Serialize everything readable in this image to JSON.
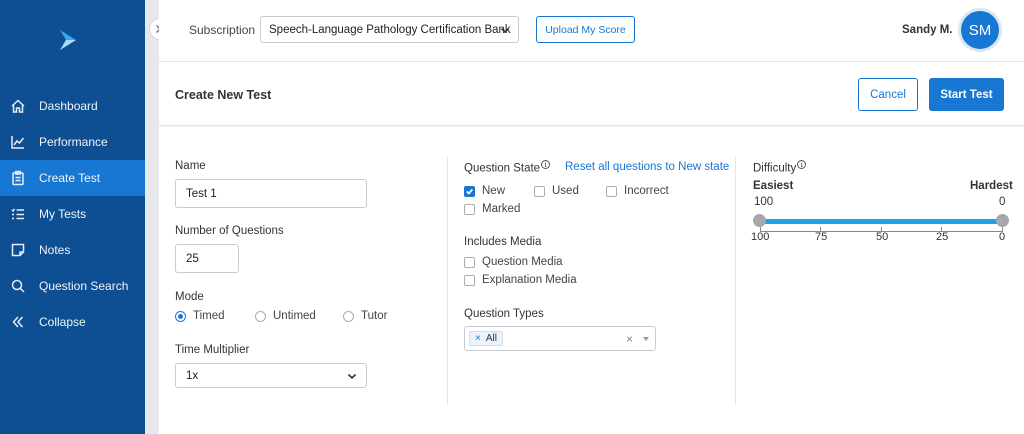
{
  "sidebar": {
    "items": [
      {
        "label": "Dashboard",
        "icon": "home-icon"
      },
      {
        "label": "Performance",
        "icon": "line-chart-icon"
      },
      {
        "label": "Create Test",
        "icon": "clipboard-icon",
        "active": true
      },
      {
        "label": "My Tests",
        "icon": "list-icon"
      },
      {
        "label": "Notes",
        "icon": "note-icon"
      },
      {
        "label": "Question Search",
        "icon": "search-icon"
      },
      {
        "label": "Collapse",
        "icon": "double-chevron-left-icon"
      }
    ]
  },
  "header": {
    "subscription_label": "Subscription",
    "subscription_value": "Speech-Language Pathology Certification Bank",
    "upload_label": "Upload My Score",
    "user_name": "Sandy M.",
    "avatar_initials": "SM"
  },
  "toolbar": {
    "title": "Create New Test",
    "cancel_label": "Cancel",
    "start_label": "Start Test"
  },
  "form": {
    "name_label": "Name",
    "name_value": "Test 1",
    "num_questions_label": "Number of Questions",
    "num_questions_value": "25",
    "mode_label": "Mode",
    "mode_options": [
      "Timed",
      "Untimed",
      "Tutor"
    ],
    "mode_selected": "Timed",
    "time_multiplier_label": "Time Multiplier",
    "time_multiplier_value": "1x",
    "question_state_label": "Question State",
    "reset_link": "Reset all questions to New state",
    "states": {
      "new": "New",
      "used": "Used",
      "incorrect": "Incorrect",
      "marked": "Marked"
    },
    "includes_media_label": "Includes Media",
    "media": {
      "question": "Question Media",
      "explanation": "Explanation Media"
    },
    "question_types_label": "Question Types",
    "question_types_tag": "All",
    "difficulty_label": "Difficulty",
    "difficulty_easiest": "Easiest",
    "difficulty_hardest": "Hardest",
    "difficulty_min_value": "100",
    "difficulty_max_value": "0",
    "difficulty_ticks": [
      "100",
      "75",
      "50",
      "25",
      "0"
    ]
  },
  "colors": {
    "sidebar_bg": "#0e4f93",
    "accent": "#1877d2",
    "slider": "#1da1e8"
  }
}
